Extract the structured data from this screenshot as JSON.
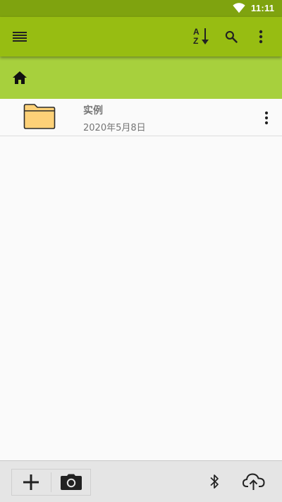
{
  "status_bar": {
    "time": "11:11"
  },
  "toolbar": {
    "icons": [
      "menu-icon",
      "sort-az-icon",
      "search-icon",
      "more-vert-icon"
    ],
    "sort_label_a": "A",
    "sort_label_z": "Z"
  },
  "path_bar": {
    "icon": "home-icon"
  },
  "files": [
    {
      "name": "实例",
      "date": "2020年5月8日",
      "icon": "folder-icon"
    }
  ],
  "bottom_bar": {
    "icons": [
      "add-icon",
      "camera-icon",
      "bluetooth-icon",
      "cloud-upload-icon"
    ]
  },
  "colors": {
    "status_bar": "#7fa30f",
    "toolbar": "#97bd12",
    "path_bar": "#a7d03d",
    "folder_fill": "#fdd178",
    "background": "#fafafa"
  }
}
